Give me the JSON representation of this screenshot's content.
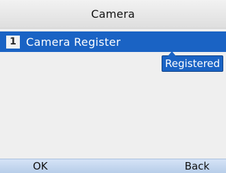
{
  "header": {
    "title": "Camera"
  },
  "menu": {
    "items": [
      {
        "index": "1",
        "label": "Camera Register"
      }
    ],
    "tooltip": "Registered"
  },
  "softkeys": {
    "left": "OK",
    "right": "Back"
  },
  "colors": {
    "selection": "#1a63c4",
    "softkey_bar": "#c6d8f0",
    "background": "#efefef"
  }
}
